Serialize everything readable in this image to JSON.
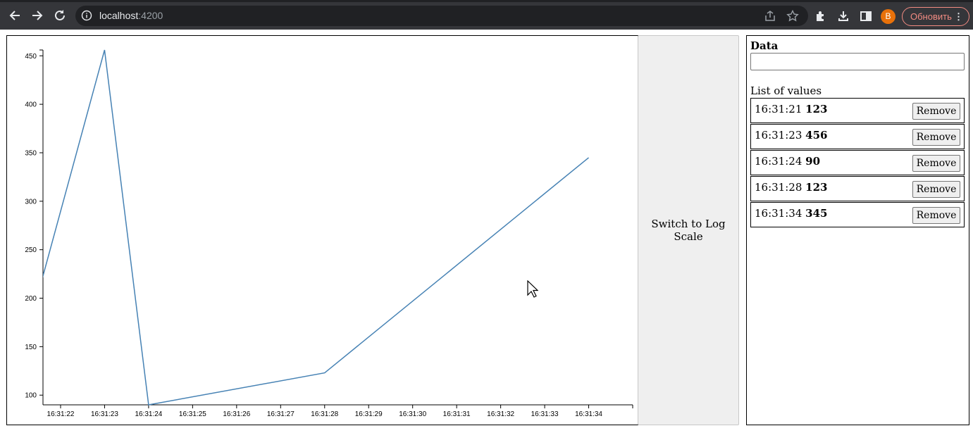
{
  "browser": {
    "url_host": "localhost",
    "url_port": ":4200",
    "avatar_letter": "B",
    "update_label": "Обновить",
    "menu_glyph": "⋮"
  },
  "form": {
    "data_label": "Data",
    "data_value": "",
    "list_title": "List of values",
    "remove_label": "Remove"
  },
  "log_button_label": "Switch to Log Scale",
  "values": [
    {
      "time": "16:31:21",
      "value": "123"
    },
    {
      "time": "16:31:23",
      "value": "456"
    },
    {
      "time": "16:31:24",
      "value": "90"
    },
    {
      "time": "16:31:28",
      "value": "123"
    },
    {
      "time": "16:31:34",
      "value": "345"
    }
  ],
  "chart_data": {
    "type": "line",
    "x": [
      "16:31:21",
      "16:31:23",
      "16:31:24",
      "16:31:28",
      "16:31:34"
    ],
    "values": [
      123,
      456,
      90,
      123,
      345
    ],
    "xlim": [
      "16:31:21.6",
      "16:31:35"
    ],
    "ylim": [
      90,
      456
    ],
    "x_ticks": [
      "16:31:22",
      "16:31:23",
      "16:31:24",
      "16:31:25",
      "16:31:26",
      "16:31:27",
      "16:31:28",
      "16:31:29",
      "16:31:30",
      "16:31:31",
      "16:31:32",
      "16:31:33",
      "16:31:34"
    ],
    "y_ticks": [
      100,
      150,
      200,
      250,
      300,
      350,
      400,
      450
    ],
    "line_color": "#4682b4",
    "grid": false
  }
}
